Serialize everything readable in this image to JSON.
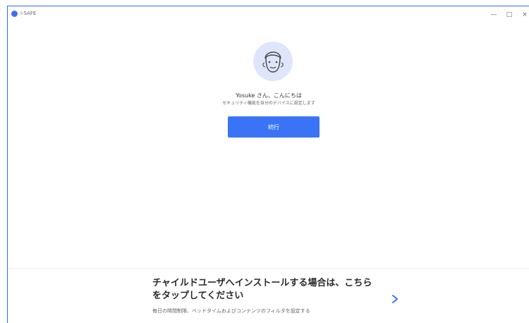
{
  "window": {
    "app_title": "i-SAFE",
    "colors": {
      "accent": "#3b73f6",
      "avatar_bg": "#dfe6fb",
      "border": "#2f6df6"
    }
  },
  "main": {
    "greeting": "Yosuke さん、こんにちは",
    "subtitle": "セキュリティ機能を自分のデバイスに設定します",
    "continue_label": "続行"
  },
  "child_banner": {
    "title": "チャイルドユーザへインストールする場合は、こちらをタップしてください",
    "description": "毎日の時間制限、ベッドタイムおよびコンテンツのフィルタを設定する",
    "chevron_icon": "chevron-right-icon"
  },
  "window_controls": {
    "minimize": "—",
    "maximize": "□",
    "close": "×"
  }
}
